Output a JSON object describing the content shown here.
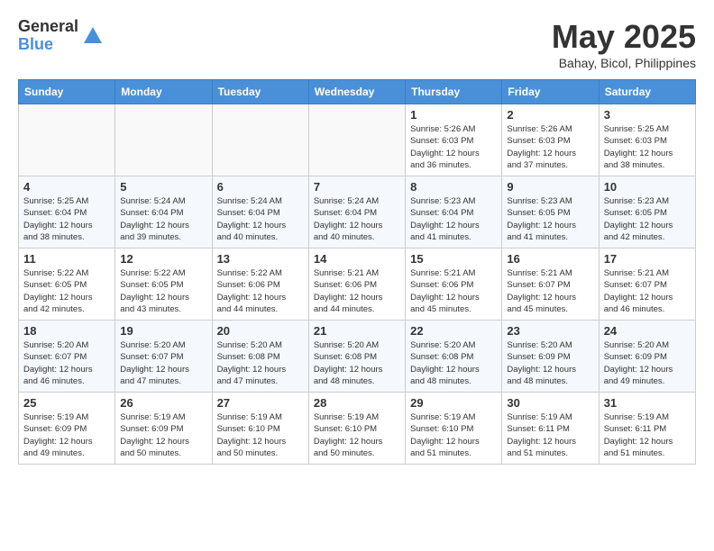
{
  "header": {
    "logo_general": "General",
    "logo_blue": "Blue",
    "title": "May 2025",
    "subtitle": "Bahay, Bicol, Philippines"
  },
  "days_of_week": [
    "Sunday",
    "Monday",
    "Tuesday",
    "Wednesday",
    "Thursday",
    "Friday",
    "Saturday"
  ],
  "weeks": [
    {
      "days": [
        {
          "date": "",
          "info": ""
        },
        {
          "date": "",
          "info": ""
        },
        {
          "date": "",
          "info": ""
        },
        {
          "date": "",
          "info": ""
        },
        {
          "date": "1",
          "info": "Sunrise: 5:26 AM\nSunset: 6:03 PM\nDaylight: 12 hours\nand 36 minutes."
        },
        {
          "date": "2",
          "info": "Sunrise: 5:26 AM\nSunset: 6:03 PM\nDaylight: 12 hours\nand 37 minutes."
        },
        {
          "date": "3",
          "info": "Sunrise: 5:25 AM\nSunset: 6:03 PM\nDaylight: 12 hours\nand 38 minutes."
        }
      ]
    },
    {
      "days": [
        {
          "date": "4",
          "info": "Sunrise: 5:25 AM\nSunset: 6:04 PM\nDaylight: 12 hours\nand 38 minutes."
        },
        {
          "date": "5",
          "info": "Sunrise: 5:24 AM\nSunset: 6:04 PM\nDaylight: 12 hours\nand 39 minutes."
        },
        {
          "date": "6",
          "info": "Sunrise: 5:24 AM\nSunset: 6:04 PM\nDaylight: 12 hours\nand 40 minutes."
        },
        {
          "date": "7",
          "info": "Sunrise: 5:24 AM\nSunset: 6:04 PM\nDaylight: 12 hours\nand 40 minutes."
        },
        {
          "date": "8",
          "info": "Sunrise: 5:23 AM\nSunset: 6:04 PM\nDaylight: 12 hours\nand 41 minutes."
        },
        {
          "date": "9",
          "info": "Sunrise: 5:23 AM\nSunset: 6:05 PM\nDaylight: 12 hours\nand 41 minutes."
        },
        {
          "date": "10",
          "info": "Sunrise: 5:23 AM\nSunset: 6:05 PM\nDaylight: 12 hours\nand 42 minutes."
        }
      ]
    },
    {
      "days": [
        {
          "date": "11",
          "info": "Sunrise: 5:22 AM\nSunset: 6:05 PM\nDaylight: 12 hours\nand 42 minutes."
        },
        {
          "date": "12",
          "info": "Sunrise: 5:22 AM\nSunset: 6:05 PM\nDaylight: 12 hours\nand 43 minutes."
        },
        {
          "date": "13",
          "info": "Sunrise: 5:22 AM\nSunset: 6:06 PM\nDaylight: 12 hours\nand 44 minutes."
        },
        {
          "date": "14",
          "info": "Sunrise: 5:21 AM\nSunset: 6:06 PM\nDaylight: 12 hours\nand 44 minutes."
        },
        {
          "date": "15",
          "info": "Sunrise: 5:21 AM\nSunset: 6:06 PM\nDaylight: 12 hours\nand 45 minutes."
        },
        {
          "date": "16",
          "info": "Sunrise: 5:21 AM\nSunset: 6:07 PM\nDaylight: 12 hours\nand 45 minutes."
        },
        {
          "date": "17",
          "info": "Sunrise: 5:21 AM\nSunset: 6:07 PM\nDaylight: 12 hours\nand 46 minutes."
        }
      ]
    },
    {
      "days": [
        {
          "date": "18",
          "info": "Sunrise: 5:20 AM\nSunset: 6:07 PM\nDaylight: 12 hours\nand 46 minutes."
        },
        {
          "date": "19",
          "info": "Sunrise: 5:20 AM\nSunset: 6:07 PM\nDaylight: 12 hours\nand 47 minutes."
        },
        {
          "date": "20",
          "info": "Sunrise: 5:20 AM\nSunset: 6:08 PM\nDaylight: 12 hours\nand 47 minutes."
        },
        {
          "date": "21",
          "info": "Sunrise: 5:20 AM\nSunset: 6:08 PM\nDaylight: 12 hours\nand 48 minutes."
        },
        {
          "date": "22",
          "info": "Sunrise: 5:20 AM\nSunset: 6:08 PM\nDaylight: 12 hours\nand 48 minutes."
        },
        {
          "date": "23",
          "info": "Sunrise: 5:20 AM\nSunset: 6:09 PM\nDaylight: 12 hours\nand 48 minutes."
        },
        {
          "date": "24",
          "info": "Sunrise: 5:20 AM\nSunset: 6:09 PM\nDaylight: 12 hours\nand 49 minutes."
        }
      ]
    },
    {
      "days": [
        {
          "date": "25",
          "info": "Sunrise: 5:19 AM\nSunset: 6:09 PM\nDaylight: 12 hours\nand 49 minutes."
        },
        {
          "date": "26",
          "info": "Sunrise: 5:19 AM\nSunset: 6:09 PM\nDaylight: 12 hours\nand 50 minutes."
        },
        {
          "date": "27",
          "info": "Sunrise: 5:19 AM\nSunset: 6:10 PM\nDaylight: 12 hours\nand 50 minutes."
        },
        {
          "date": "28",
          "info": "Sunrise: 5:19 AM\nSunset: 6:10 PM\nDaylight: 12 hours\nand 50 minutes."
        },
        {
          "date": "29",
          "info": "Sunrise: 5:19 AM\nSunset: 6:10 PM\nDaylight: 12 hours\nand 51 minutes."
        },
        {
          "date": "30",
          "info": "Sunrise: 5:19 AM\nSunset: 6:11 PM\nDaylight: 12 hours\nand 51 minutes."
        },
        {
          "date": "31",
          "info": "Sunrise: 5:19 AM\nSunset: 6:11 PM\nDaylight: 12 hours\nand 51 minutes."
        }
      ]
    }
  ]
}
